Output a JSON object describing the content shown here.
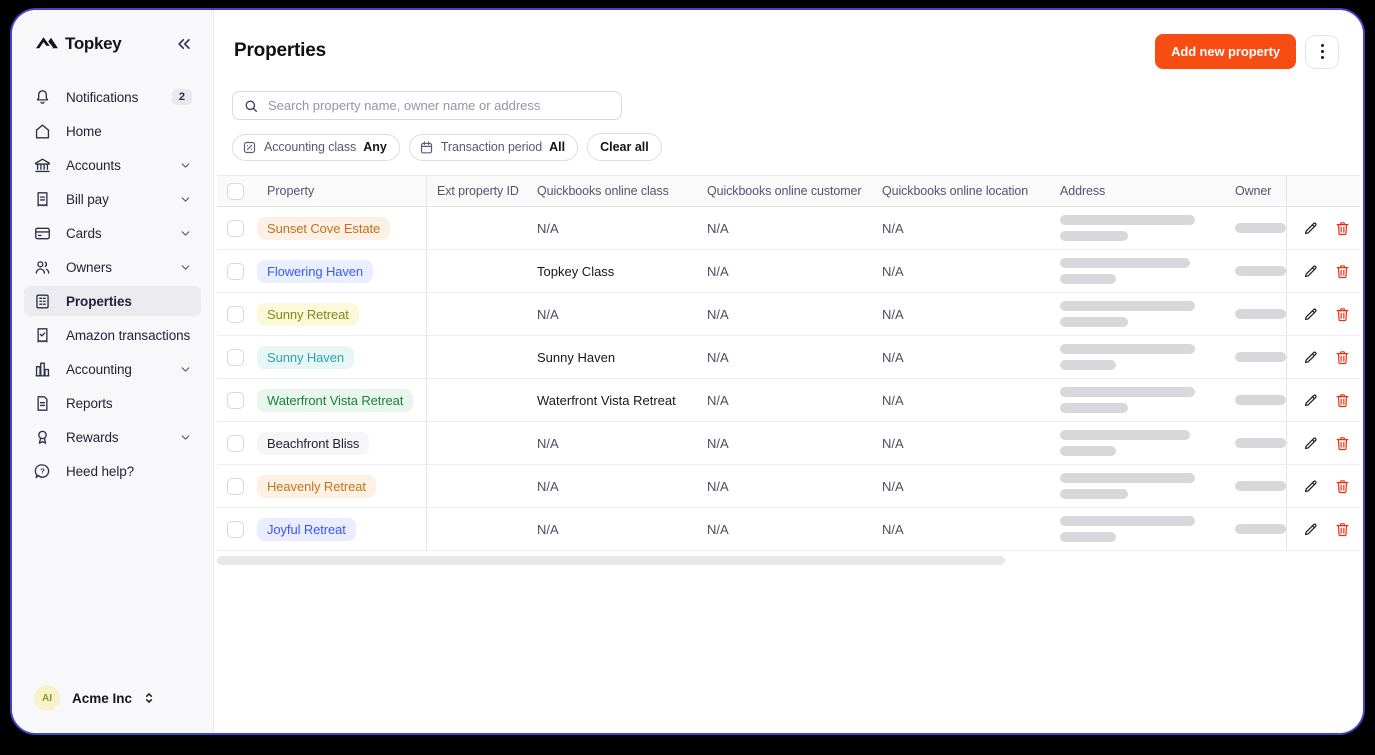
{
  "colors": {
    "accent": "#f74c12",
    "danger": "#ee2f0d"
  },
  "brand": {
    "name": "Topkey",
    "logo_icon": "mountain-logo-icon",
    "collapse_icon": "double-chevron-left-icon"
  },
  "sidebar": {
    "items": [
      {
        "label": "Notifications",
        "icon": "bell-icon",
        "badge": "2"
      },
      {
        "label": "Home",
        "icon": "home-icon"
      },
      {
        "label": "Accounts",
        "icon": "bank-icon",
        "chevron": true
      },
      {
        "label": "Bill pay",
        "icon": "receipt-icon",
        "chevron": true
      },
      {
        "label": "Cards",
        "icon": "credit-card-icon",
        "chevron": true
      },
      {
        "label": "Owners",
        "icon": "people-icon",
        "chevron": true
      },
      {
        "label": "Properties",
        "icon": "building-icon",
        "active": true
      },
      {
        "label": "Amazon transactions",
        "icon": "receipt-check-icon"
      },
      {
        "label": "Accounting",
        "icon": "bar-chart-icon",
        "chevron": true
      },
      {
        "label": "Reports",
        "icon": "document-icon"
      },
      {
        "label": "Rewards",
        "icon": "medal-icon",
        "chevron": true
      },
      {
        "label": "Heed help?",
        "icon": "help-bubble-icon"
      }
    ],
    "org": {
      "initials": "AI",
      "name": "Acme Inc",
      "selector_icon": "up-down-chevron-icon"
    }
  },
  "header": {
    "title": "Properties",
    "add_button_label": "Add new property",
    "kebab_icon": "kebab-menu-icon"
  },
  "search": {
    "placeholder": "Search property name, owner name or address",
    "icon": "search-icon"
  },
  "filters": {
    "chips": [
      {
        "label": "Accounting class",
        "value": "Any",
        "icon": "percent-square-icon"
      },
      {
        "label": "Transaction period",
        "value": "All",
        "icon": "calendar-icon"
      }
    ],
    "clear_all_label": "Clear all"
  },
  "table": {
    "columns": [
      "Property",
      "Ext property ID",
      "Quickbooks online class",
      "Quickbooks online customer",
      "Quickbooks online location",
      "Address",
      "Owner"
    ],
    "rows": [
      {
        "property": "Sunset Cove Estate",
        "pill_fg": "#c0701f",
        "pill_bg": "#fcf1e4",
        "ext_id": "",
        "qb_class": "N/A",
        "qb_customer": "N/A",
        "qb_location": "N/A"
      },
      {
        "property": "Flowering Haven",
        "pill_fg": "#3a5bf0",
        "pill_bg": "#e9efff",
        "ext_id": "",
        "qb_class": "Topkey Class",
        "qb_customer": "N/A",
        "qb_location": "N/A"
      },
      {
        "property": "Sunny Retreat",
        "pill_fg": "#7d8c16",
        "pill_bg": "#fbf9da",
        "ext_id": "",
        "qb_class": "N/A",
        "qb_customer": "N/A",
        "qb_location": "N/A"
      },
      {
        "property": "Sunny Haven",
        "pill_fg": "#2ba3ac",
        "pill_bg": "#e9f6f7",
        "ext_id": "",
        "qb_class": "Sunny Haven",
        "qb_customer": "N/A",
        "qb_location": "N/A"
      },
      {
        "property": "Waterfront Vista Retreat",
        "pill_fg": "#1d8043",
        "pill_bg": "#e8f6ec",
        "ext_id": "",
        "qb_class": "Waterfront Vista Retreat",
        "qb_customer": "N/A",
        "qb_location": "N/A"
      },
      {
        "property": "Beachfront Bliss",
        "pill_fg": "#23232e",
        "pill_bg": "#f6f6f9",
        "ext_id": "",
        "qb_class": "N/A",
        "qb_customer": "N/A",
        "qb_location": "N/A"
      },
      {
        "property": "Heavenly Retreat",
        "pill_fg": "#c2761c",
        "pill_bg": "#fcf1e2",
        "ext_id": "",
        "qb_class": "N/A",
        "qb_customer": "N/A",
        "qb_location": "N/A"
      },
      {
        "property": "Joyful Retreat",
        "pill_fg": "#3a56ee",
        "pill_bg": "#e9edff",
        "ext_id": "",
        "qb_class": "N/A",
        "qb_customer": "N/A",
        "qb_location": "N/A"
      }
    ],
    "actions": {
      "edit_icon": "pencil-icon",
      "delete_icon": "trash-icon"
    }
  }
}
